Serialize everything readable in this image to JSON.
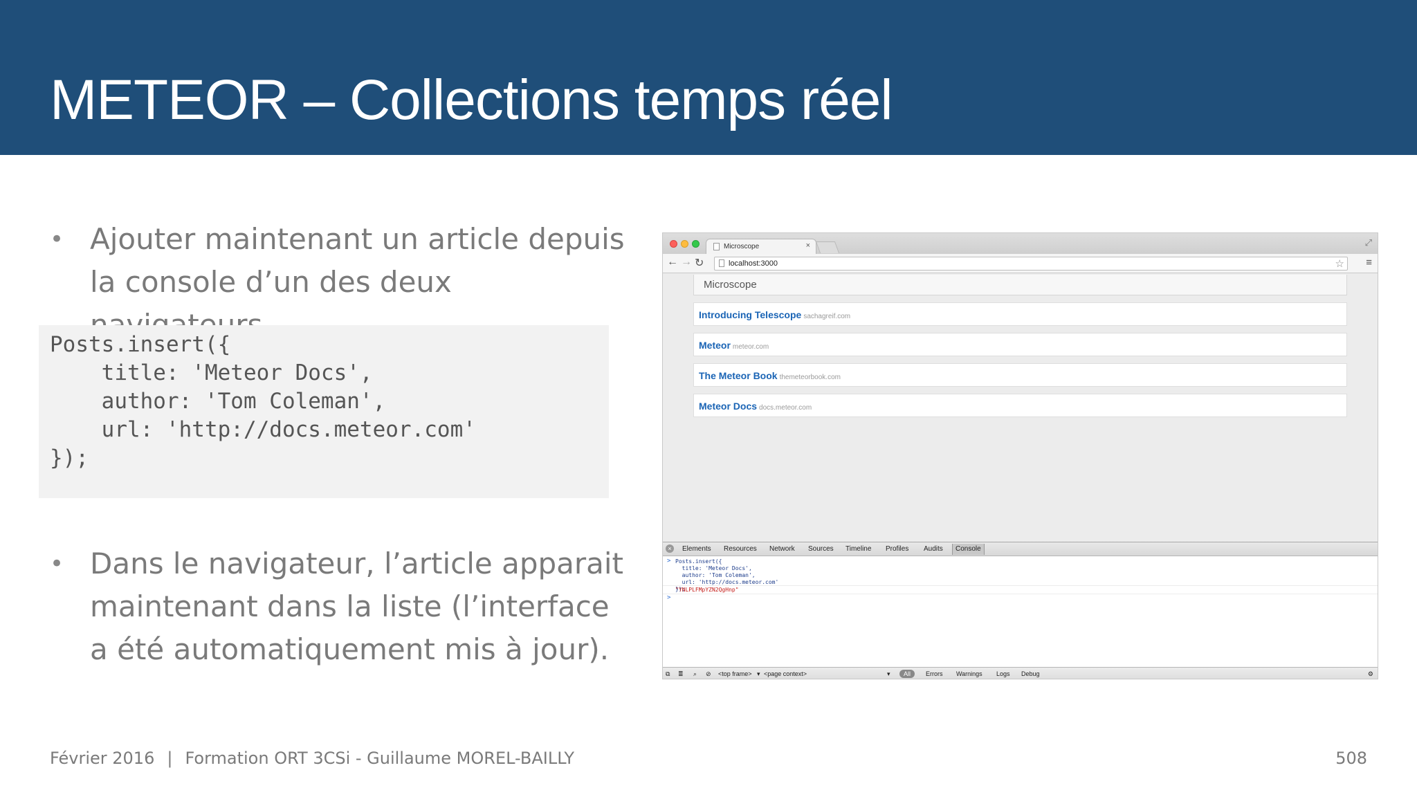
{
  "slide": {
    "title": "METEOR – Collections temps réel",
    "bullets": [
      "Ajouter maintenant un article depuis la console d’un des deux navigateurs.",
      "Dans le navigateur, l’article apparait maintenant dans la liste (l’interface a été automatiquement mis à jour)."
    ],
    "bullet_symbol": "•",
    "code": "Posts.insert({\n    title: 'Meteor Docs',\n    author: 'Tom Coleman',\n    url: 'http://docs.meteor.com'\n});",
    "footer": {
      "date": "Février 2016",
      "separator": "|",
      "course": "Formation ORT 3CSi - Guillaume MOREL-BAILLY",
      "page_number": "508"
    }
  },
  "browser": {
    "tab_title": "Microscope",
    "tab_close": "×",
    "url": "localhost:3000",
    "app_brand": "Microscope",
    "posts": [
      {
        "title": "Introducing Telescope",
        "domain": "sachagreif.com"
      },
      {
        "title": "Meteor",
        "domain": "meteor.com"
      },
      {
        "title": "The Meteor Book",
        "domain": "themeteorbook.com"
      },
      {
        "title": "Meteor Docs",
        "domain": "docs.meteor.com"
      }
    ],
    "devtools": {
      "tabs": [
        "Elements",
        "Resources",
        "Network",
        "Sources",
        "Timeline",
        "Profiles",
        "Audits",
        "Console"
      ],
      "active_tab": "Console",
      "console_input": "Posts.insert({\n  title: 'Meteor Docs',\n  author: 'Tom Coleman',\n  url: 'http://docs.meteor.com'\n});",
      "console_result": "\"YNLPLFMpYZN2QgHnp\"",
      "prompt": ">",
      "status": {
        "frame_select": "<top frame>",
        "context_select": "<page context>",
        "filter_all": "All",
        "filters": [
          "Errors",
          "Warnings",
          "Logs",
          "Debug"
        ]
      }
    }
  },
  "colors": {
    "header_bg": "#1f4e79",
    "link_blue": "#1a64b5",
    "body_text": "#7a7a7a"
  }
}
